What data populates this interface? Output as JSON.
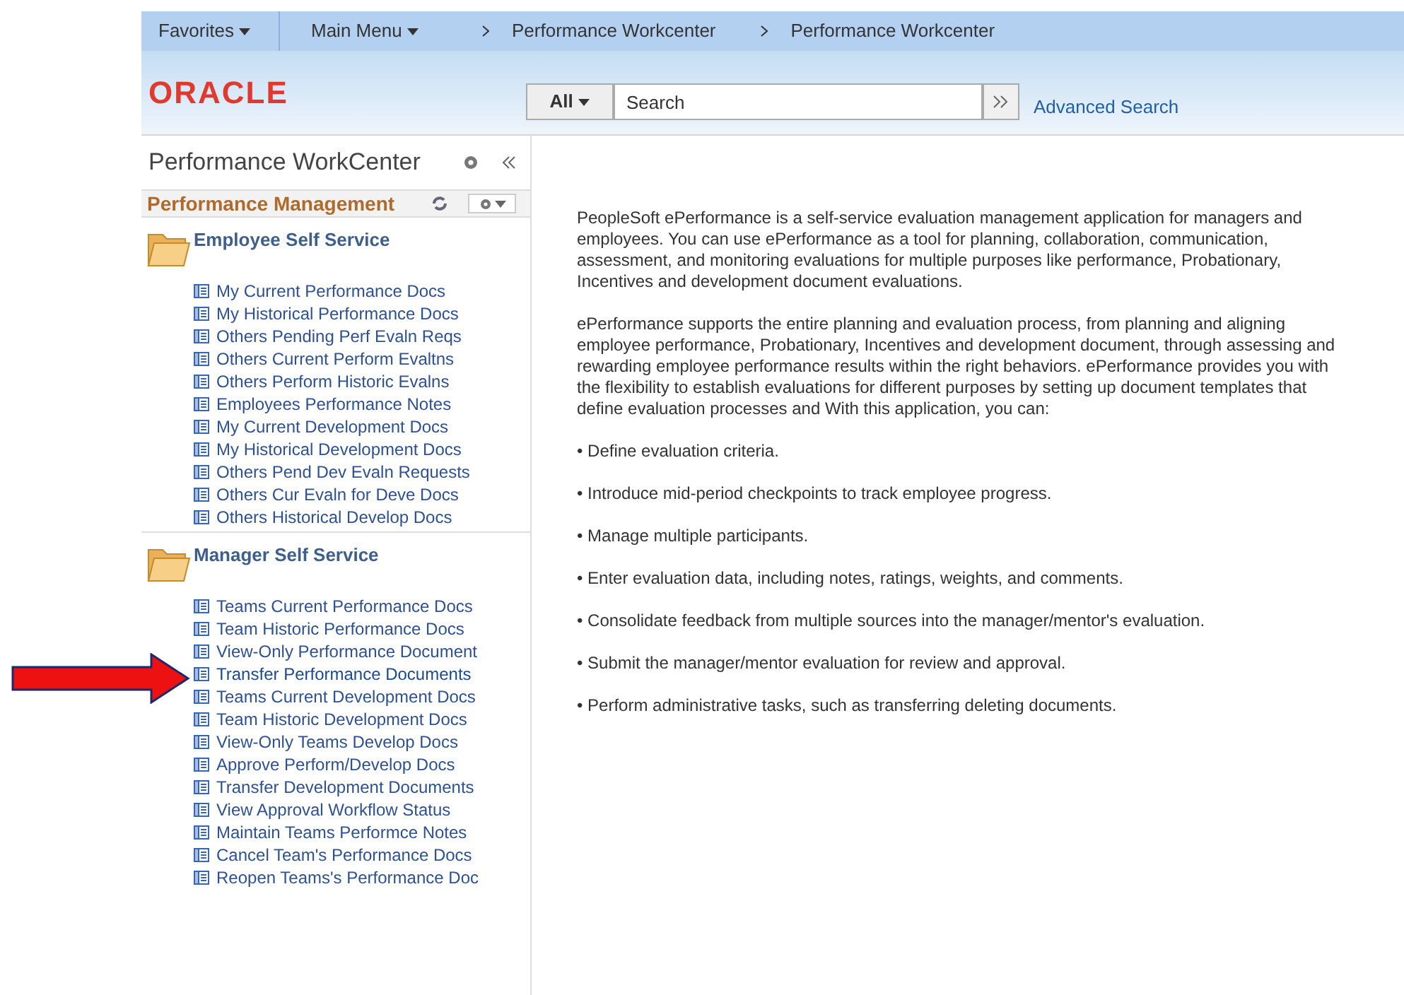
{
  "nav": {
    "items": [
      {
        "label": "Favorites",
        "kind": "menu"
      },
      {
        "label": "Main Menu",
        "kind": "menu"
      },
      {
        "label": "Performance Workcenter",
        "kind": "crumb"
      },
      {
        "label": "Performance Workcenter",
        "kind": "crumb"
      }
    ]
  },
  "header": {
    "logo": "ORACLE",
    "search_scope": "All",
    "search_placeholder": "Search",
    "advanced_search": "Advanced Search"
  },
  "sidebar": {
    "title": "Performance WorkCenter",
    "pagelet_title": "Performance Management",
    "sections": [
      {
        "title": "Employee Self Service",
        "links": [
          {
            "label": "My Current Performance Docs",
            "selected": false
          },
          {
            "label": "My Historical Performance Docs",
            "selected": false
          },
          {
            "label": "Others Pending Perf Evaln Reqs",
            "selected": false
          },
          {
            "label": "Others Current Perform Evaltns",
            "selected": false
          },
          {
            "label": "Others Perform Historic Evalns",
            "selected": false
          },
          {
            "label": "Employees Performance Notes",
            "selected": false
          },
          {
            "label": "My Current Development Docs",
            "selected": false
          },
          {
            "label": "My Historical Development Docs",
            "selected": false
          },
          {
            "label": "Others Pend Dev Evaln Requests",
            "selected": false
          },
          {
            "label": "Others Cur Evaln for Deve Docs",
            "selected": false
          },
          {
            "label": "Others Historical Develop Docs",
            "selected": false
          }
        ]
      },
      {
        "title": "Manager Self Service",
        "links": [
          {
            "label": "Teams Current Performance Docs",
            "selected": false
          },
          {
            "label": "Team Historic Performance Docs",
            "selected": false
          },
          {
            "label": "View-Only Performance Document",
            "selected": false
          },
          {
            "label": "Transfer Performance Documents",
            "selected": true
          },
          {
            "label": "Teams Current Development Docs",
            "selected": false
          },
          {
            "label": "Team Historic Development Docs",
            "selected": false
          },
          {
            "label": "View-Only Teams Develop Docs",
            "selected": false
          },
          {
            "label": "Approve Perform/Develop Docs",
            "selected": false
          },
          {
            "label": "Transfer Development Documents",
            "selected": false
          },
          {
            "label": "View Approval Workflow Status",
            "selected": false
          },
          {
            "label": "Maintain Teams Performce Notes",
            "selected": false
          },
          {
            "label": "Cancel Team's Performance Docs",
            "selected": false
          },
          {
            "label": "Reopen Teams's Performance Doc",
            "selected": false
          }
        ]
      }
    ]
  },
  "content": {
    "paragraphs": [
      "PeopleSoft ePerformance is a self-service evaluation management application for managers and employees. You can use ePerformance as a tool for planning, collaboration, communication, assessment, and monitoring evaluations for multiple purposes like performance, Probationary, Incentives and development document evaluations.",
      "ePerformance supports the entire planning and evaluation process, from planning and aligning employee performance, Probationary, Incentives and development document, through assessing and rewarding employee performance results within the right behaviors. ePerformance provides you with the flexibility to establish evaluations for different purposes by setting up document templates that define evaluation processes and With this application, you can:"
    ],
    "bullets": [
      "• Define evaluation criteria.",
      "• Introduce mid-period checkpoints to track employee progress.",
      "• Manage multiple participants.",
      "• Enter evaluation data, including notes, ratings, weights, and comments.",
      "• Consolidate feedback from multiple sources into the manager/mentor's evaluation.",
      "• Submit the manager/mentor evaluation for review and approval.",
      "• Perform administrative tasks, such as transferring deleting documents."
    ]
  }
}
